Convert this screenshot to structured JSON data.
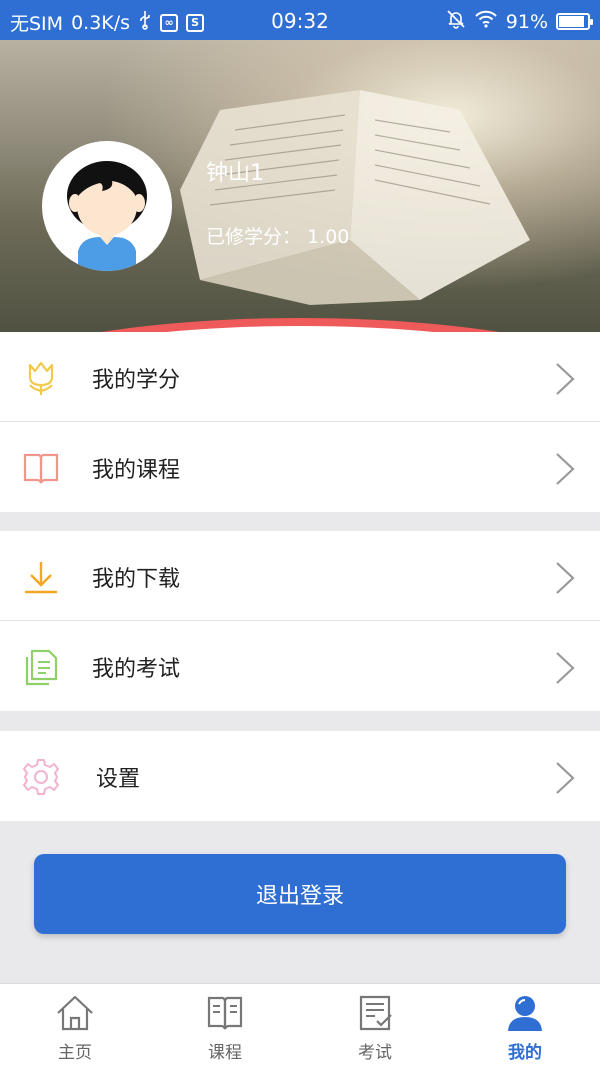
{
  "status_bar": {
    "carrier": "无SIM",
    "speed": "0.3K/s",
    "time": "09:32",
    "battery": "91%",
    "battery_level": 0.91
  },
  "profile": {
    "name": "钟山1",
    "credit_label": "已修学分：",
    "credit_value": "1.00"
  },
  "menu_groups": [
    [
      {
        "label": "我的学分",
        "icon": "tulip-icon",
        "color": "#f2c94c"
      },
      {
        "label": "我的课程",
        "icon": "book-icon",
        "color": "#f0968c"
      }
    ],
    [
      {
        "label": "我的下载",
        "icon": "download-icon",
        "color": "#f5a623"
      },
      {
        "label": "我的考试",
        "icon": "document-icon",
        "color": "#8fd06a"
      }
    ],
    [
      {
        "label": "设置",
        "icon": "gear-icon",
        "color": "#f3b3cf"
      }
    ]
  ],
  "logout_label": "退出登录",
  "bottom_nav": [
    {
      "label": "主页",
      "icon": "home-icon",
      "active": false
    },
    {
      "label": "课程",
      "icon": "open-book-icon",
      "active": false
    },
    {
      "label": "考试",
      "icon": "exam-icon",
      "active": false
    },
    {
      "label": "我的",
      "icon": "user-icon",
      "active": true
    }
  ],
  "colors": {
    "primary": "#2f6fd3",
    "accent_red": "#ef5a5a"
  }
}
